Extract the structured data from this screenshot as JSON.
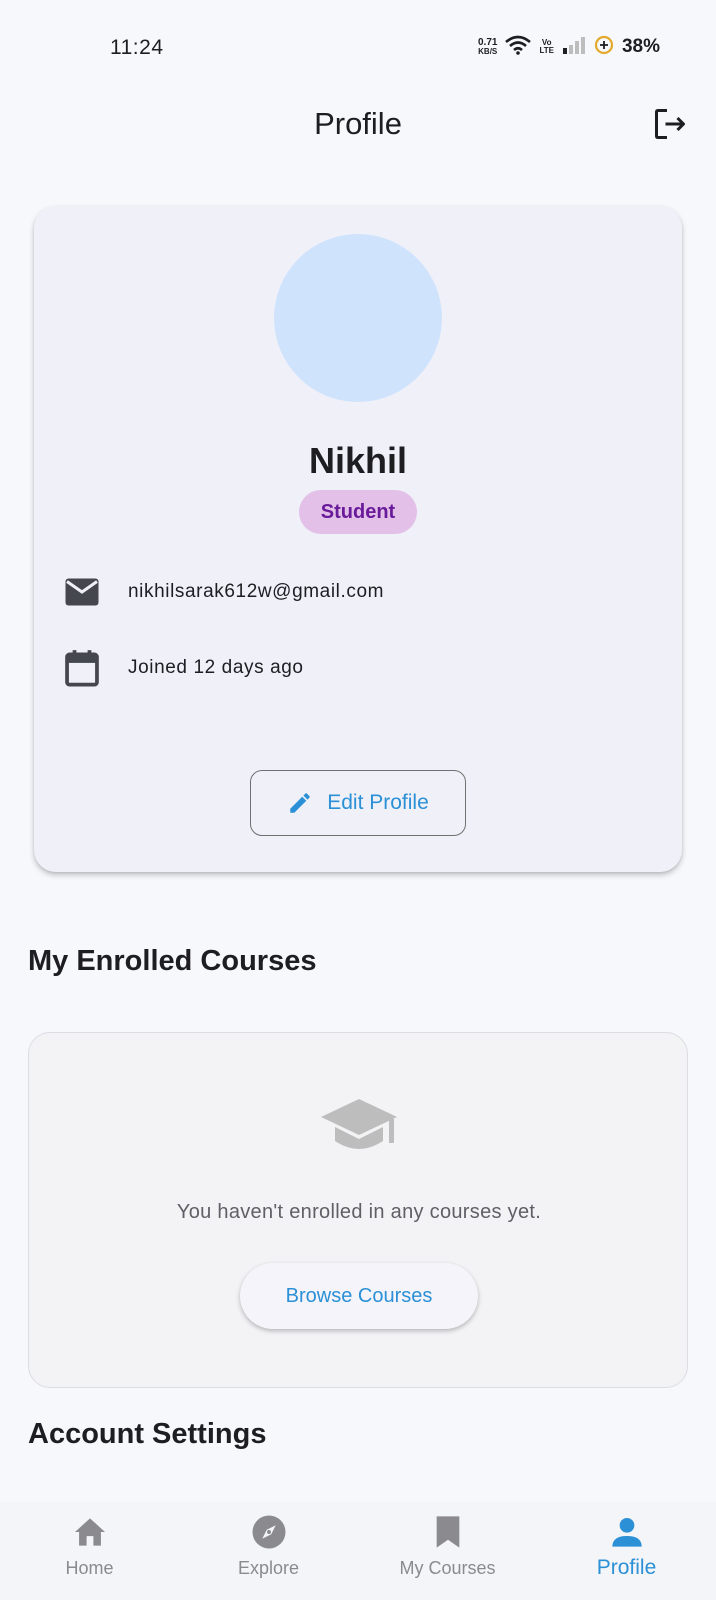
{
  "status_bar": {
    "time": "11:24",
    "net_speed_value": "0.71",
    "net_speed_unit": "KB/S",
    "volte_top": "Vo",
    "volte_bottom": "LTE",
    "battery_percent": "38%"
  },
  "header": {
    "title": "Profile",
    "logout_icon": "logout-icon"
  },
  "profile": {
    "name": "Nikhil",
    "role": "Student",
    "email": "nikhilsarak612w@gmail.com",
    "joined": "Joined 12 days ago",
    "edit_button_label": "Edit Profile",
    "avatar_color": "#d0e3fd",
    "badge_color": "#e2c0e8",
    "badge_text_color": "#6a1b9a"
  },
  "enrolled": {
    "section_title": "My Enrolled Courses",
    "empty_icon": "graduation-cap-icon",
    "empty_message": "You haven't enrolled in any courses yet.",
    "browse_button_label": "Browse Courses"
  },
  "account_settings": {
    "section_title": "Account Settings"
  },
  "bottom_nav": {
    "items": [
      {
        "label": "Home",
        "icon": "home-icon",
        "active": false
      },
      {
        "label": "Explore",
        "icon": "compass-icon",
        "active": false
      },
      {
        "label": "My Courses",
        "icon": "bookmark-icon",
        "active": false
      },
      {
        "label": "Profile",
        "icon": "person-icon",
        "active": true
      }
    ]
  },
  "colors": {
    "accent": "#2b90d6",
    "background": "#f7f8fc",
    "inactive": "#8a8a8f"
  }
}
